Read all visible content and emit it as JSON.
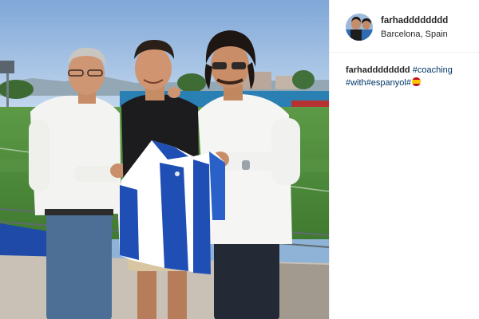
{
  "post": {
    "username": "farhadddddddd",
    "location": "Barcelona, Spain",
    "caption": {
      "username": "farhadddddddd",
      "hashtags": [
        "#coaching",
        "#with",
        "#espanyol",
        "#"
      ],
      "emoji_icon": "spain-flag-emoji"
    }
  },
  "colors": {
    "hashtag": "#003569",
    "text": "#262626",
    "divider": "#efefef",
    "jersey_blue": "#1f4fb5",
    "pitch_green": "#4f8a3c"
  },
  "icons": {
    "avatar": "profile-picture",
    "flag": "spain-flag-emoji"
  }
}
